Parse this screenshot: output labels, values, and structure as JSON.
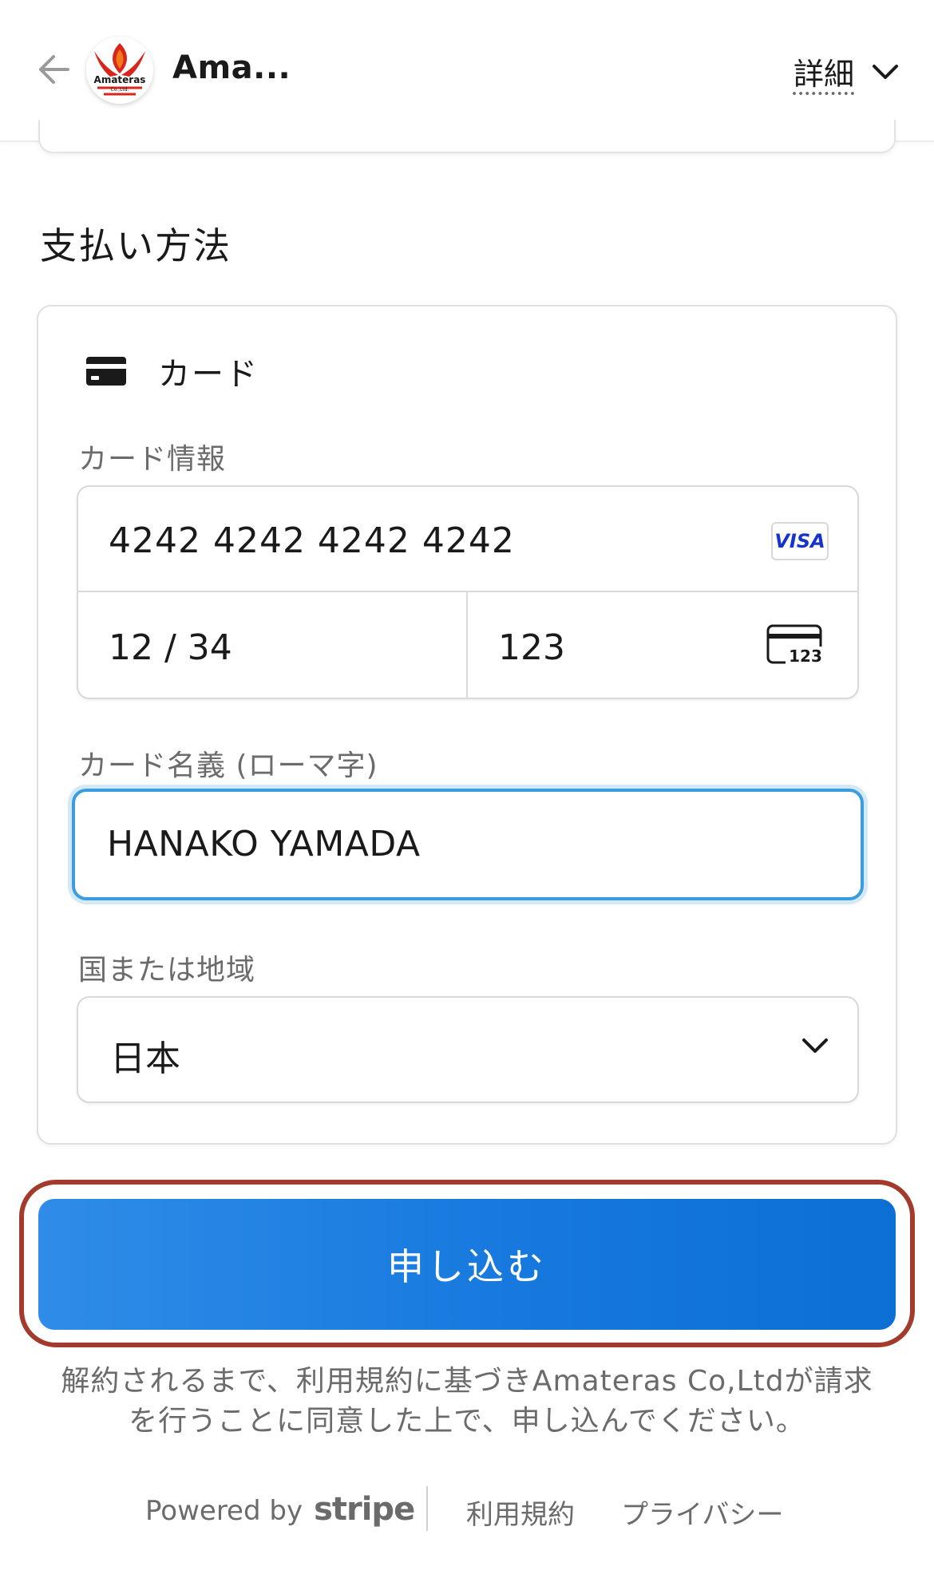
{
  "header": {
    "merchant_name": "Ama...",
    "details_label": "詳細"
  },
  "section": {
    "title": "支払い方法"
  },
  "payment_method": {
    "type_label": "カード",
    "card_info_label": "カード情報",
    "card_number": "4242 4242 4242 4242",
    "card_brand": "VISA",
    "expiry": "12 / 34",
    "cvc": "123",
    "cvc_icon_text": "123",
    "name_label": "カード名義 (ローマ字)",
    "name_value": "HANAKO YAMADA",
    "country_label": "国または地域",
    "country_value": "日本"
  },
  "actions": {
    "subscribe_label": "申し込む"
  },
  "agreement": {
    "line1": "解約されるまで、利用規約に基づきAmateras Co,Ltdが請求",
    "line2": "を行うことに同意した上で、申し込んでください。"
  },
  "footer": {
    "powered_by": "Powered by",
    "stripe": "stripe",
    "terms": "利用規約",
    "privacy": "プライバシー"
  },
  "logo": {
    "text": "Amateras",
    "subtext": "Co.,Ltd."
  },
  "colors": {
    "accent": "#1779de",
    "focus": "#3b9de0",
    "highlight_outline": "#a23b2c",
    "logo_red": "#d9261c",
    "logo_orange": "#f07a1a"
  },
  "icons": {
    "back": "arrow-left-icon",
    "details_chevron": "chevron-down-icon",
    "card": "credit-card-icon",
    "cvc": "card-cvc-icon",
    "country_chevron": "chevron-down-icon"
  }
}
